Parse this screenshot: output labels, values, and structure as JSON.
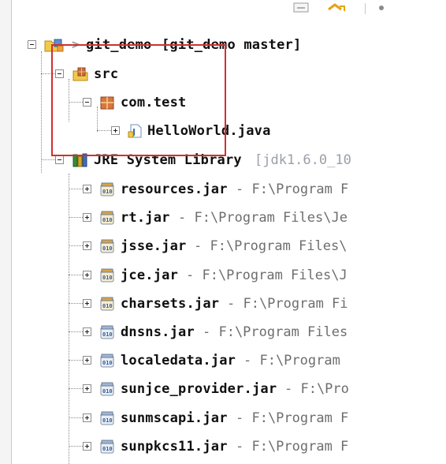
{
  "project": {
    "name": "git_demo",
    "decoration": "[git_demo master]",
    "arrow": ">"
  },
  "src": {
    "label": "src"
  },
  "package": {
    "label": "com.test"
  },
  "file": {
    "label": "HelloWorld.java"
  },
  "library": {
    "label": "JRE System Library",
    "version": "[jdk1.6.0_10"
  },
  "jars": [
    {
      "name": "resources.jar",
      "path": "- F:\\Program F",
      "kind": "jar"
    },
    {
      "name": "rt.jar",
      "path": "- F:\\Program Files\\Je",
      "kind": "jar"
    },
    {
      "name": "jsse.jar",
      "path": "- F:\\Program Files\\",
      "kind": "jar"
    },
    {
      "name": "jce.jar",
      "path": "- F:\\Program Files\\J",
      "kind": "jar"
    },
    {
      "name": "charsets.jar",
      "path": "- F:\\Program Fi",
      "kind": "jar"
    },
    {
      "name": "dnsns.jar",
      "path": "- F:\\Program Files",
      "kind": "ext"
    },
    {
      "name": "localedata.jar",
      "path": "- F:\\Program",
      "kind": "ext"
    },
    {
      "name": "sunjce_provider.jar",
      "path": "- F:\\Pro",
      "kind": "ext"
    },
    {
      "name": "sunmscapi.jar",
      "path": "- F:\\Program F",
      "kind": "ext"
    },
    {
      "name": "sunpkcs11.jar",
      "path": "- F:\\Program F",
      "kind": "ext"
    }
  ],
  "colors": {
    "highlight_box": "#d0302f",
    "path_text": "#6e6e6e",
    "decoration_text": "#9aa0a6"
  }
}
